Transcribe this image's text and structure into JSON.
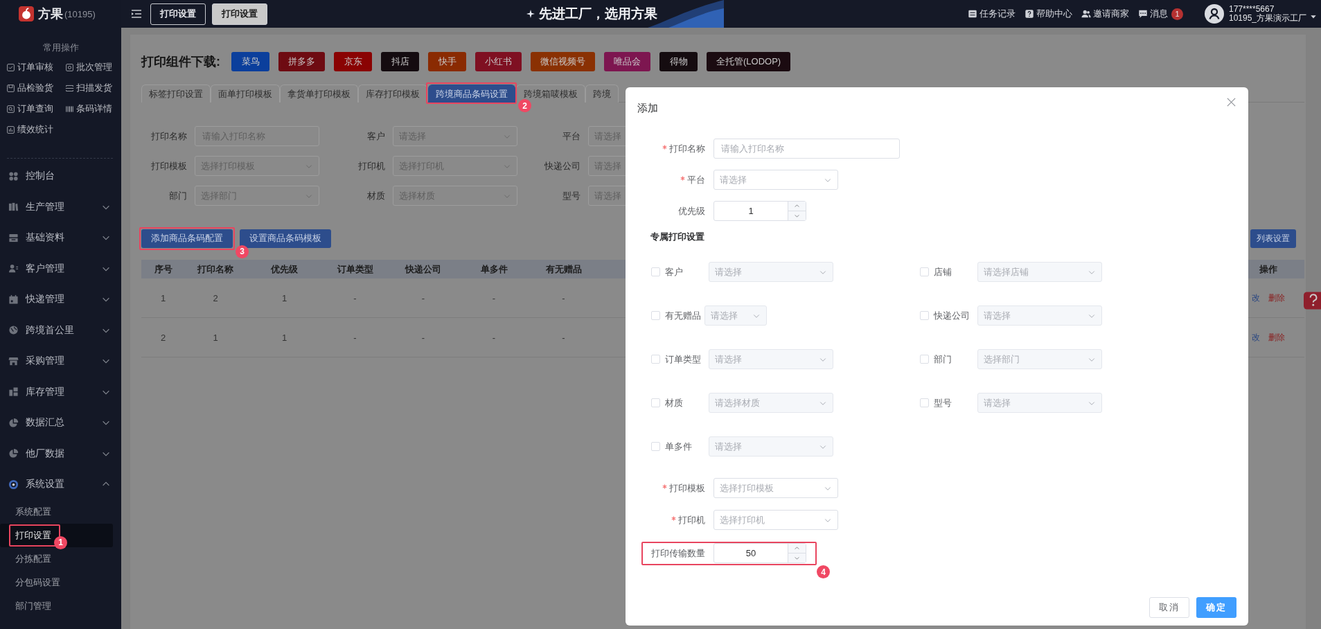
{
  "app": {
    "logo": "方果",
    "account_id": "(10195)"
  },
  "header": {
    "tabs": [
      {
        "label": "打印设置",
        "selected": false
      },
      {
        "label": "打印设置",
        "selected": true
      }
    ],
    "slogan": "先进工厂，选用方果",
    "links": [
      "任务记录",
      "帮助中心",
      "邀请商家"
    ],
    "messages": {
      "label": "消息",
      "count": "1"
    },
    "user": {
      "phone": "177****5667",
      "org": "10195_方果演示工厂"
    }
  },
  "sidebar": {
    "quick_title": "常用操作",
    "quick_actions": [
      "订单审核",
      "批次管理",
      "品检验货",
      "扫描发货",
      "订单查询",
      "条码详情",
      "绩效统计"
    ],
    "menu": [
      {
        "label": "控制台"
      },
      {
        "label": "生产管理",
        "expanded": false
      },
      {
        "label": "基础资料",
        "expanded": false
      },
      {
        "label": "客户管理",
        "expanded": false
      },
      {
        "label": "快递管理",
        "expanded": false
      },
      {
        "label": "跨境首公里",
        "expanded": false
      },
      {
        "label": "采购管理",
        "expanded": false
      },
      {
        "label": "库存管理",
        "expanded": false
      },
      {
        "label": "数据汇总",
        "expanded": false
      },
      {
        "label": "他厂数据",
        "expanded": false
      },
      {
        "label": "系统设置",
        "expanded": true,
        "children": [
          {
            "label": "系统配置",
            "selected": false
          },
          {
            "label": "打印设置",
            "selected": true,
            "callout": "1"
          },
          {
            "label": "分拣配置",
            "selected": false
          },
          {
            "label": "分包码设置",
            "selected": false
          },
          {
            "label": "部门管理",
            "selected": false
          }
        ]
      }
    ]
  },
  "download": {
    "label": "打印组件下载:",
    "buttons": [
      {
        "label": "菜鸟",
        "color": "#0b3f9c"
      },
      {
        "label": "拼多多",
        "color": "#6e0b12"
      },
      {
        "label": "京东",
        "color": "#8a0303"
      },
      {
        "label": "抖店",
        "color": "#140b10"
      },
      {
        "label": "快手",
        "color": "#8a2b02"
      },
      {
        "label": "小红书",
        "color": "#7f1022"
      },
      {
        "label": "微信视频号",
        "color": "#8a3103"
      },
      {
        "label": "唯品会",
        "color": "#7d1650"
      },
      {
        "label": "得物",
        "color": "#150c10"
      },
      {
        "label": "全托管(LODOP)",
        "color": "#1b0b11"
      }
    ]
  },
  "tabs": [
    {
      "label": "标签打印设置",
      "selected": false
    },
    {
      "label": "面单打印模板",
      "selected": false
    },
    {
      "label": "拿货单打印模板",
      "selected": false
    },
    {
      "label": "库存打印模板",
      "selected": false
    },
    {
      "label": "跨境商品条码设置",
      "selected": true,
      "callout": "2"
    },
    {
      "label": "跨境箱唛模板",
      "selected": false
    },
    {
      "label": "跨境",
      "selected": false
    }
  ],
  "filters": [
    {
      "label": "打印名称",
      "kind": "input",
      "placeholder": "请输入打印名称"
    },
    {
      "label": "客户",
      "kind": "select",
      "placeholder": "请选择"
    },
    {
      "label": "平台",
      "kind": "select",
      "placeholder": "请选择"
    },
    {
      "label": "打印模板",
      "kind": "select",
      "placeholder": "选择打印模板"
    },
    {
      "label": "打印机",
      "kind": "select",
      "placeholder": "选择打印机"
    },
    {
      "label": "快递公司",
      "kind": "select",
      "placeholder": "请选择"
    },
    {
      "label": "部门",
      "kind": "select",
      "placeholder": "选择部门"
    },
    {
      "label": "材质",
      "kind": "select",
      "placeholder": "选择材质"
    },
    {
      "label": "型号",
      "kind": "select",
      "placeholder": "请选择"
    }
  ],
  "actions": [
    {
      "label": "添加商品条码配置",
      "callout": "3"
    },
    {
      "label": "设置商品条码模板"
    }
  ],
  "list_settings": "列表设置",
  "table": {
    "columns": [
      "序号",
      "打印名称",
      "优先级",
      "订单类型",
      "快递公司",
      "单多件",
      "有无赠品"
    ],
    "action_column": "操作",
    "rows": [
      {
        "cells": [
          "1",
          "2",
          "1",
          "-",
          "-",
          "-",
          "-"
        ],
        "actions": [
          {
            "label": "改",
            "kind": "edit"
          },
          {
            "label": "删除",
            "kind": "delete"
          }
        ]
      },
      {
        "cells": [
          "2",
          "1",
          "1",
          "-",
          "-",
          "-",
          "-"
        ],
        "actions": [
          {
            "label": "改",
            "kind": "edit"
          },
          {
            "label": "删除",
            "kind": "delete"
          }
        ]
      }
    ]
  },
  "dialog": {
    "title": "添加",
    "fields": [
      {
        "label": "打印名称",
        "required": true,
        "kind": "input",
        "placeholder": "请输入打印名称"
      },
      {
        "label": "平台",
        "required": true,
        "kind": "select",
        "placeholder": "请选择"
      },
      {
        "label": "优先级",
        "required": false,
        "kind": "number",
        "value": "1"
      }
    ],
    "section": "专属打印设置",
    "options": [
      {
        "label": "客户",
        "checked": false,
        "placeholder": "请选择",
        "compact": false
      },
      {
        "label": "店铺",
        "checked": false,
        "placeholder": "请选择店铺",
        "compact": false
      },
      {
        "label": "有无赠品",
        "checked": false,
        "placeholder": "请选择",
        "compact": true
      },
      {
        "label": "快递公司",
        "checked": false,
        "placeholder": "请选择",
        "compact": false
      },
      {
        "label": "订单类型",
        "checked": false,
        "placeholder": "请选择",
        "compact": false
      },
      {
        "label": "部门",
        "checked": false,
        "placeholder": "选择部门",
        "compact": false
      },
      {
        "label": "材质",
        "checked": false,
        "placeholder": "请选择材质",
        "compact": false
      },
      {
        "label": "型号",
        "checked": false,
        "placeholder": "请选择",
        "compact": false
      },
      {
        "label": "单多件",
        "checked": false,
        "placeholder": "请选择",
        "compact": false
      }
    ],
    "print_fields": [
      {
        "label": "打印模板",
        "required": true,
        "kind": "select",
        "placeholder": "选择打印模板"
      },
      {
        "label": "打印机",
        "required": true,
        "kind": "select",
        "placeholder": "选择打印机"
      },
      {
        "label": "打印传输数量",
        "required": false,
        "kind": "number",
        "value": "50",
        "callout": "4"
      }
    ],
    "buttons": [
      {
        "label": "取消",
        "kind": "secondary"
      },
      {
        "label": "确定",
        "kind": "primary"
      }
    ]
  }
}
